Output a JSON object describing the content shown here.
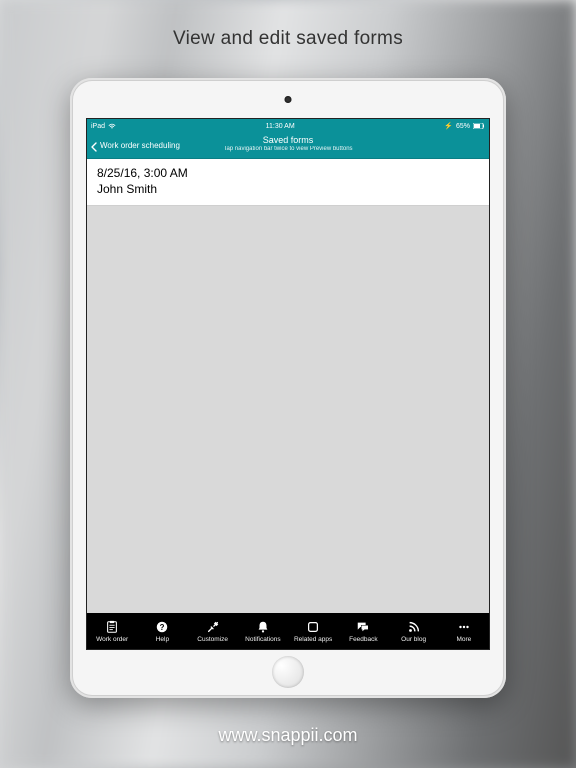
{
  "hero": {
    "text": "View and edit saved forms"
  },
  "footer": {
    "text": "www.snappii.com"
  },
  "status": {
    "carrier": "iPad",
    "time": "11:30 AM",
    "battery": "65%"
  },
  "nav": {
    "back_label": "Work order scheduling",
    "title": "Saved forms",
    "subtitle": "Tap navigation bar twice to view Preview buttons"
  },
  "list": {
    "items": [
      {
        "primary": "8/25/16, 3:00 AM",
        "secondary": "John Smith"
      }
    ]
  },
  "tabs": [
    {
      "label": "Work order",
      "icon": "clipboard-icon"
    },
    {
      "label": "Help",
      "icon": "help-icon"
    },
    {
      "label": "Customize",
      "icon": "tools-icon"
    },
    {
      "label": "Notifications",
      "icon": "bell-icon"
    },
    {
      "label": "Related apps",
      "icon": "app-icon"
    },
    {
      "label": "Feedback",
      "icon": "chat-icon"
    },
    {
      "label": "Our blog",
      "icon": "rss-icon"
    },
    {
      "label": "More",
      "icon": "more-icon"
    }
  ]
}
